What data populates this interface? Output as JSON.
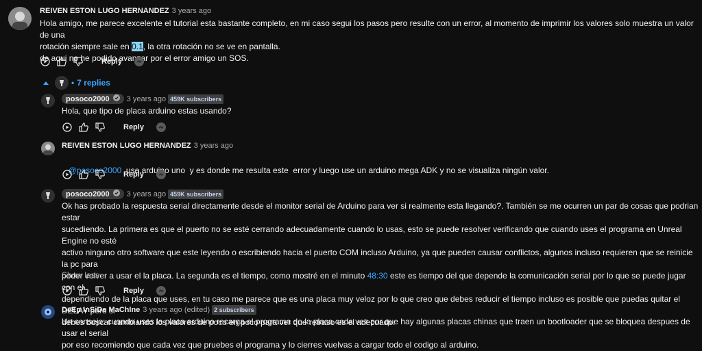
{
  "comment1": {
    "author": "REIVEN ESTON LUGO HERNANDEZ",
    "time": "3 years ago",
    "line1": "Hola amigo, me parece excelente el tutorial esta bastante completo, en mi caso segui los pasos pero resulte con un error, al momento de imprimir los valores solo muestra un valor de una",
    "line2a": "rotación siempre sale en ",
    "line2b": "0.1",
    "line2c": ", la otra rotación no se ve en pantalla.",
    "line3": "de aqui no he podido avanzar por el error amigo un SOS.",
    "reply": "Reply"
  },
  "replies_toggle": {
    "label": "7 replies"
  },
  "reply1": {
    "author": "posoco2000",
    "time": "3 years ago",
    "badge": "459K subscribers",
    "text": "Hola, que tipo de placa arduino estas usando?",
    "reply": "Reply"
  },
  "reply2": {
    "author": "REIVEN ESTON LUGO HERNANDEZ",
    "time": "3 years ago",
    "mention": "@posoco2000",
    "text": "  use arduino uno  y es donde me resulta este  error y luego use un arduino mega ADK y no se visualiza ningún valor.",
    "reply": "Reply"
  },
  "reply3": {
    "author": "posoco2000",
    "time": "3 years ago",
    "badge": "459K subscribers",
    "l1": "Ok has probado la respuesta serial directamente desde el monitor serial de Arduino para ver si realmente esta llegando?. También se me ocurren un par de cosas que podrian estar",
    "l2": "sucediendo. La primera es que el puerto no se esté cerrando adecuadamente cuando lo usas, esto se puede resolver verificando que cuando uses el programa en Unreal Engine no esté",
    "l3": "activo ninguno otro software que este leyendo o escribiendo hacia el puerto COM incluso Arduino, ya que pueden causar conflictos, algunos incluso requieren que se reinicie la pc para",
    "l4a": "poder volver a usar el la placa. La segunda es el tiempo, como mostré en el minuto ",
    "l4ts": "48:30",
    "l4b": " este es tiempo del que depende la comunicación serial por lo que se puede jugar con el",
    "l5": "dependiendo de la placa que uses, en tu caso me parece que es una placa muy veloz por lo que creo que debes reducir el tiempo incluso es posible que puedas quitar el DELAY pero si",
    "l6": "debes buscar cambiando los valores de poco en poco para ver que retraso es el adecuado.",
    "show_less": "Show less",
    "reply": "Reply"
  },
  "reply4": {
    "author": "DeEp InSiDe MaChIne",
    "time": "3 years ago (edited)",
    "badge": "2 subscribers",
    "l1": "Un consejo: cuando uses la placa arduino recarga el programa de la placa cada vez por que hay algunas placas chinas que traen un bootloader que se bloquea despues de usar el serial",
    "l2": "por eso recomiendo que cada vez que pruebes el programa y lo cierres vuelvas a cargar todo el codigo al arduino."
  },
  "icons": {
    "play": "play-circle-icon",
    "like": "thumb-up-icon",
    "dislike": "thumb-down-icon",
    "disabled": "disabled-circle-icon",
    "caret": "caret-up-icon"
  },
  "colors": {
    "background": "#0f0f0f",
    "link": "#3ea6ff",
    "text": "#f1f1f1",
    "muted": "#aaaaaa"
  }
}
